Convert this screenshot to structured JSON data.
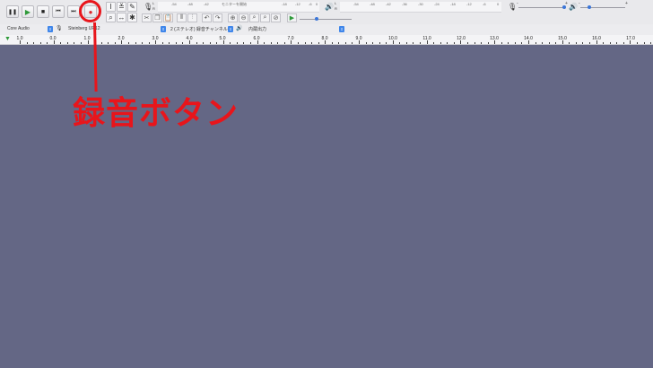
{
  "transport": {
    "buttons": [
      {
        "name": "pause",
        "glyph": "❚❚"
      },
      {
        "name": "play",
        "glyph": "▶"
      },
      {
        "name": "stop",
        "glyph": "■"
      },
      {
        "name": "skip-start",
        "glyph": "⏮"
      },
      {
        "name": "skip-end",
        "glyph": "⏭"
      },
      {
        "name": "record",
        "glyph": "●"
      }
    ]
  },
  "meters": {
    "record_scale": [
      "-54",
      "-48",
      "-42",
      "モニターを開始",
      "-18",
      "-12",
      "-6",
      "0"
    ],
    "play_scale": [
      "-54",
      "-48",
      "-42",
      "-36",
      "-30",
      "-24",
      "-18",
      "-12",
      "-6",
      "0"
    ],
    "lr": [
      "L",
      "R"
    ],
    "minus": "-",
    "plus": "+"
  },
  "devices": {
    "host": "Core Audio",
    "input_device": "Steinberg UR12",
    "channels": "2 (ステレオ) 録音チャンネル",
    "output_device": "内蔵出力"
  },
  "ruler": {
    "marks": [
      "1.0",
      "0.0",
      "1.0",
      "2.0",
      "3.0",
      "4.0",
      "5.0",
      "6.0",
      "7.0",
      "8.0",
      "9.0",
      "10.0",
      "11.0",
      "12.0",
      "13.0",
      "14.0",
      "15.0",
      "16.0",
      "17.0"
    ]
  },
  "annotation": {
    "label": "録音ボタン",
    "color": "#e8151b"
  },
  "colors": {
    "workspace": "#646785",
    "record": "#d9282e",
    "play": "#2f9a3a",
    "accent": "#3f86ea"
  }
}
